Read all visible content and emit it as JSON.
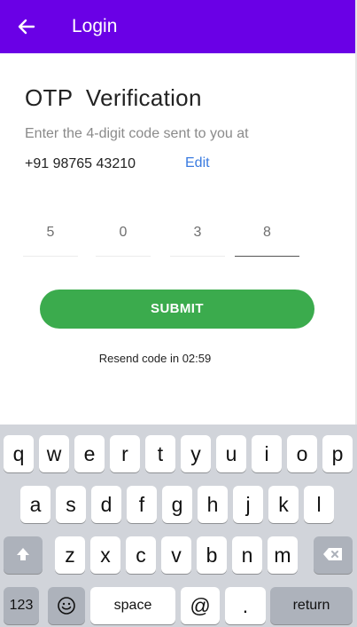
{
  "header": {
    "title": "Login"
  },
  "page": {
    "title": "OTP  Verification",
    "subtitle": "Enter the 4-digit code sent to you at",
    "phone": "+91 98765 43210",
    "edit_label": "Edit",
    "otp_digits": [
      "5",
      "0",
      "3",
      "8"
    ],
    "submit_label": "SUBMIT",
    "resend_text": "Resend code in 02:59"
  },
  "keyboard": {
    "row1": [
      "q",
      "w",
      "e",
      "r",
      "t",
      "y",
      "u",
      "i",
      "o",
      "p"
    ],
    "row2": [
      "a",
      "s",
      "d",
      "f",
      "g",
      "h",
      "j",
      "k",
      "l"
    ],
    "row3": [
      "z",
      "x",
      "c",
      "v",
      "b",
      "n",
      "m"
    ],
    "numbers_label": "123",
    "space_label": "space",
    "at_label": "@",
    "dot_label": ".",
    "return_label": "return"
  },
  "colors": {
    "appbar": "#6a00e6",
    "submit": "#3bab4d",
    "link": "#3a7be0"
  }
}
